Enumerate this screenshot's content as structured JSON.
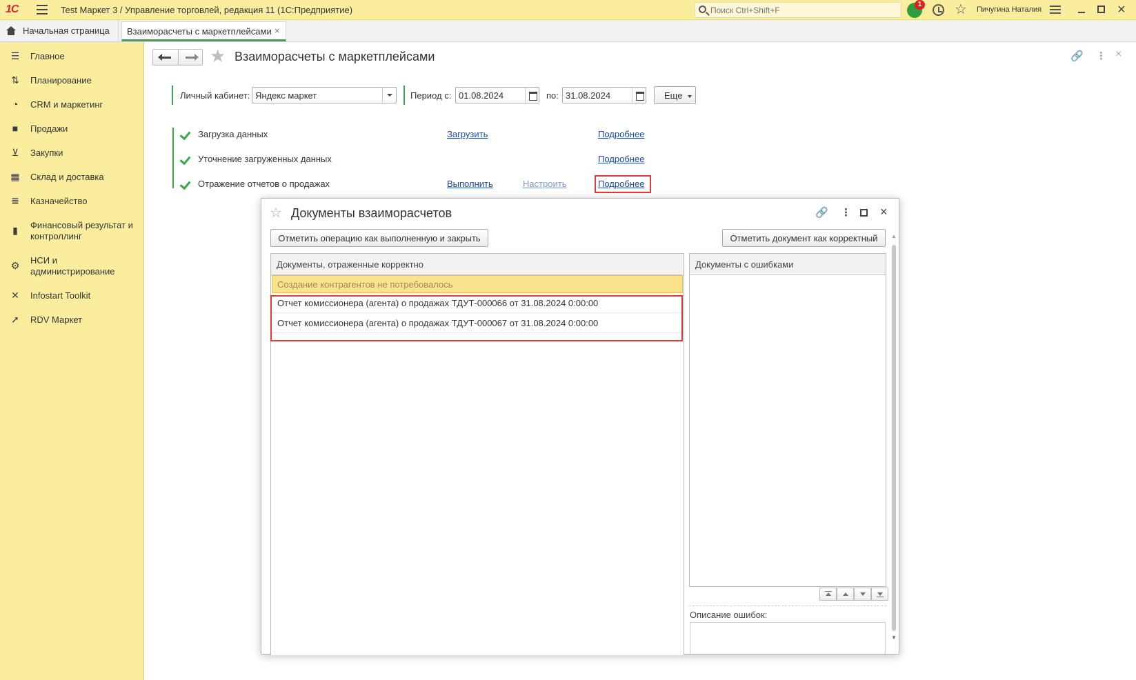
{
  "titlebar": {
    "logo_text": "1С",
    "title": "Test Маркет 3 / Управление торговлей, редакция 11  (1С:Предприятие)",
    "search_placeholder": "Поиск Ctrl+Shift+F",
    "notification_count": "1",
    "user_name": "Пичугина Наталия"
  },
  "tabs": {
    "home_label": "Начальная страница",
    "active_label": "Взаиморасчеты с маркетплейсами",
    "close_glyph": "×"
  },
  "sidebar": {
    "items": [
      {
        "label": "Главное",
        "icon": "list-icon"
      },
      {
        "label": "Планирование",
        "icon": "planning-icon"
      },
      {
        "label": "CRM и маркетинг",
        "icon": "crm-icon"
      },
      {
        "label": "Продажи",
        "icon": "sales-bag-icon"
      },
      {
        "label": "Закупки",
        "icon": "cart-icon"
      },
      {
        "label": "Склад и доставка",
        "icon": "warehouse-icon"
      },
      {
        "label": "Казначейство",
        "icon": "coins-icon"
      },
      {
        "label": "Финансовый результат и контроллинг",
        "icon": "bar-chart-icon"
      },
      {
        "label": "НСИ и администрирование",
        "icon": "gear-icon"
      },
      {
        "label": "Infostart Toolkit",
        "icon": "tools-icon"
      },
      {
        "label": "RDV Маркет",
        "icon": "rocket-icon"
      }
    ]
  },
  "form": {
    "title": "Взаиморасчеты с маркетплейсами",
    "account_label": "Личный кабинет:",
    "account_value": "Яндекс маркет",
    "period_from_label": "Период с:",
    "period_from_value": "01.08.2024",
    "period_to_label": "по:",
    "period_to_value": "31.08.2024",
    "more_button": "Еще",
    "steps": [
      {
        "label": "Загрузка данных",
        "action": "Загрузить",
        "details": "Подробнее"
      },
      {
        "label": "Уточнение загруженных данных",
        "details": "Подробнее"
      },
      {
        "label": "Отражение отчетов о продажах",
        "action": "Выполнить",
        "settings": "Настроить",
        "details": "Подробнее"
      }
    ]
  },
  "modal": {
    "title": "Документы взаиморасчетов",
    "mark_done_button": "Отметить операцию как выполненную и закрыть",
    "mark_correct_button": "Отметить документ как корректный",
    "correct_panel_header": "Документы, отраженные корректно",
    "highlight_row": "Создание контрагентов не потребовалось",
    "rows": [
      "Отчет комиссионера (агента) о продажах ТДУТ-000066 от 31.08.2024 0:00:00",
      "Отчет комиссионера (агента) о продажах ТДУТ-000067 от 31.08.2024 0:00:00"
    ],
    "errors_panel_header": "Документы с ошибками",
    "error_description_label": "Описание ошибок:"
  },
  "colors": {
    "accent_yellow": "#fbed9e",
    "accent_green": "#3aa64a",
    "highlight_red": "#e03b3b",
    "link_blue": "#1a4ba0"
  }
}
